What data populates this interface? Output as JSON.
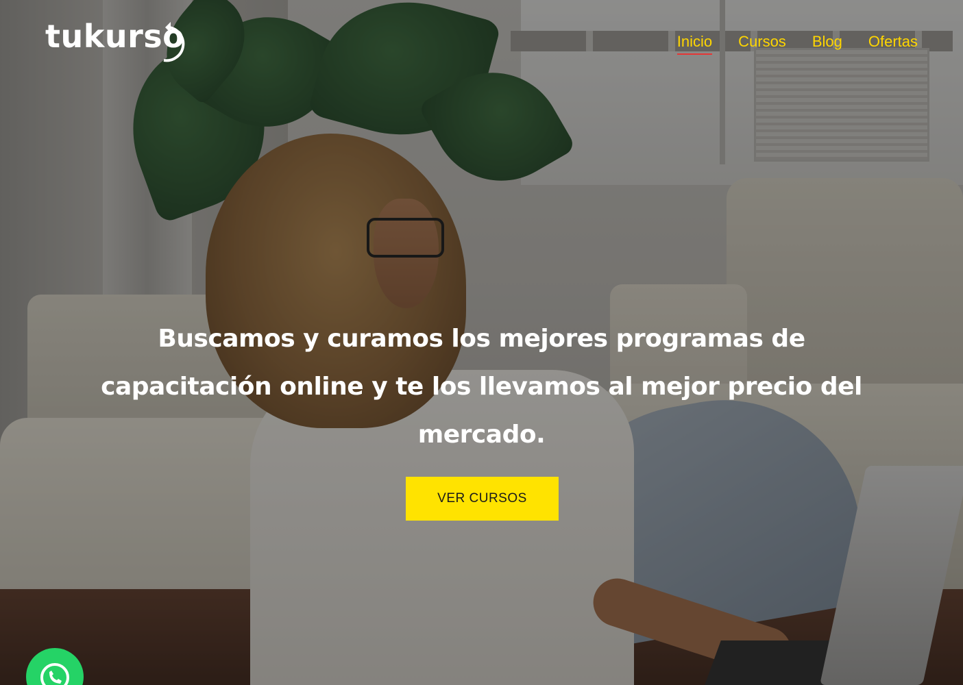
{
  "brand": {
    "logo_text": "tukurso"
  },
  "nav": {
    "items": [
      {
        "label": "Inicio",
        "active": true
      },
      {
        "label": "Cursos",
        "active": false
      },
      {
        "label": "Blog",
        "active": false
      },
      {
        "label": "Ofertas",
        "active": false
      }
    ]
  },
  "hero": {
    "headline": "Buscamos y curamos los mejores programas de capacitación online y te los llevamos al mejor precio del mercado.",
    "cta_label": "VER CURSOS"
  },
  "floating": {
    "whatsapp_icon": "whatsapp-icon"
  },
  "colors": {
    "nav_text": "#ffd600",
    "nav_active_underline": "#e63535",
    "cta_background": "#ffe300",
    "whatsapp_green": "#25d366"
  }
}
